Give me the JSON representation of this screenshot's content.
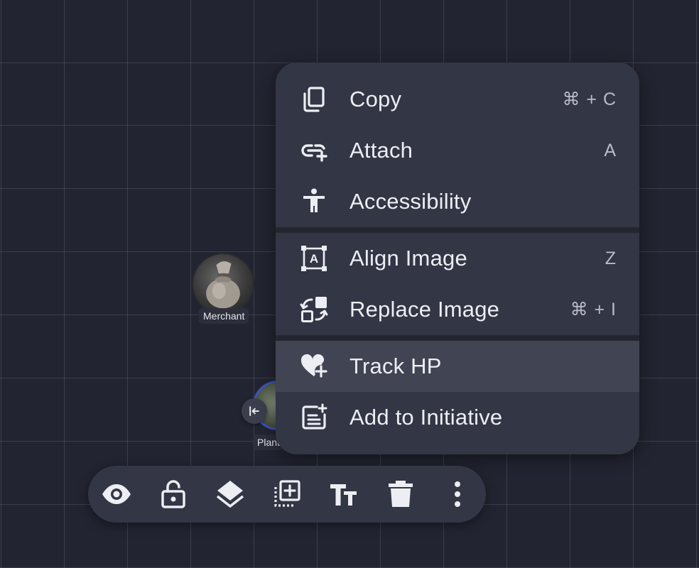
{
  "tokens": {
    "merchant": {
      "label": "Merchant"
    },
    "plant": {
      "label": "Plant"
    }
  },
  "context_menu": {
    "items": [
      {
        "id": "copy",
        "label": "Copy",
        "shortcut": "⌘ + C",
        "icon": "copy-icon"
      },
      {
        "id": "attach",
        "label": "Attach",
        "shortcut": "A",
        "icon": "attach-link-icon"
      },
      {
        "id": "accessibility",
        "label": "Accessibility",
        "shortcut": "",
        "icon": "accessibility-icon"
      },
      {
        "id": "align-image",
        "label": "Align Image",
        "shortcut": "Z",
        "icon": "align-image-icon"
      },
      {
        "id": "replace-image",
        "label": "Replace Image",
        "shortcut": "⌘ + I",
        "icon": "replace-image-icon"
      },
      {
        "id": "track-hp",
        "label": "Track HP",
        "shortcut": "",
        "icon": "heart-plus-icon",
        "highlighted": true
      },
      {
        "id": "add-to-initiative",
        "label": "Add to Initiative",
        "shortcut": "",
        "icon": "list-add-icon"
      }
    ]
  },
  "toolbar": {
    "buttons": [
      "visibility-eye-icon",
      "unlock-icon",
      "layers-icon",
      "duplicate-icon",
      "text-size-icon",
      "delete-trash-icon",
      "more-vertical-icon"
    ]
  },
  "colors": {
    "background": "#222431",
    "menu": "#333644",
    "menu_highlight": "#414452",
    "text": "#eceef4"
  }
}
